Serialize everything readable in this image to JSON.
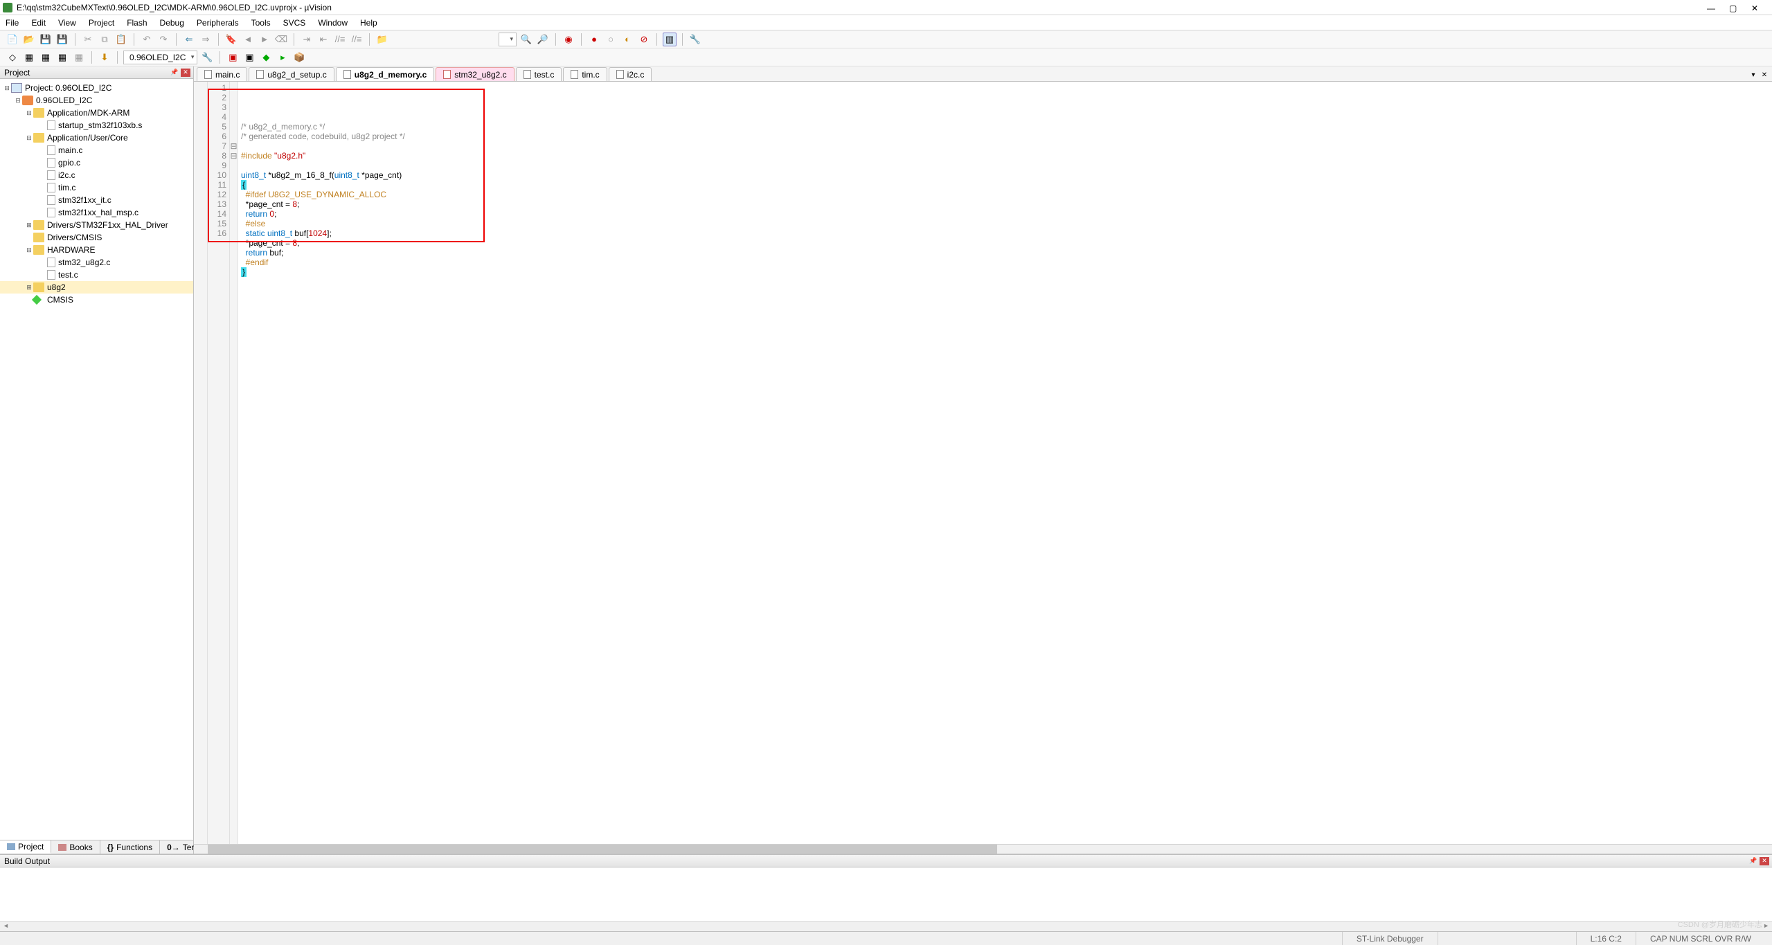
{
  "window": {
    "title": "E:\\qq\\stm32CubeMXText\\0.96OLED_I2C\\MDK-ARM\\0.96OLED_I2C.uvprojx - µVision"
  },
  "menu": [
    "File",
    "Edit",
    "View",
    "Project",
    "Flash",
    "Debug",
    "Peripherals",
    "Tools",
    "SVCS",
    "Window",
    "Help"
  ],
  "target_dropdown": "0.96OLED_I2C",
  "project_panel": {
    "title": "Project",
    "root": "Project: 0.96OLED_I2C",
    "target": "0.96OLED_I2C",
    "groups": [
      {
        "name": "Application/MDK-ARM",
        "expanded": true,
        "files": [
          "startup_stm32f103xb.s"
        ]
      },
      {
        "name": "Application/User/Core",
        "expanded": true,
        "files": [
          "main.c",
          "gpio.c",
          "i2c.c",
          "tim.c",
          "stm32f1xx_it.c",
          "stm32f1xx_hal_msp.c"
        ]
      },
      {
        "name": "Drivers/STM32F1xx_HAL_Driver",
        "expanded": false,
        "files": []
      },
      {
        "name": "Drivers/CMSIS",
        "expanded": false,
        "files": []
      },
      {
        "name": "HARDWARE",
        "expanded": true,
        "files": [
          "stm32_u8g2.c",
          "test.c"
        ]
      },
      {
        "name": "u8g2",
        "expanded": false,
        "files": [],
        "selected": true
      },
      {
        "name": "CMSIS",
        "expanded": false,
        "files": [],
        "diamond": true
      }
    ],
    "footer_tabs": [
      "Project",
      "Books",
      "Functions",
      "Templates"
    ]
  },
  "editor": {
    "tabs": [
      {
        "label": "main.c",
        "kind": "normal"
      },
      {
        "label": "u8g2_d_setup.c",
        "kind": "normal"
      },
      {
        "label": "u8g2_d_memory.c",
        "kind": "active"
      },
      {
        "label": "stm32_u8g2.c",
        "kind": "red"
      },
      {
        "label": "test.c",
        "kind": "normal"
      },
      {
        "label": "tim.c",
        "kind": "normal"
      },
      {
        "label": "i2c.c",
        "kind": "normal"
      }
    ],
    "line_start": 1,
    "code_lines": [
      {
        "n": 1,
        "text": "/* u8g2_d_memory.c */",
        "cls": "comment"
      },
      {
        "n": 2,
        "text": "/* generated code, codebuild, u8g2 project */",
        "cls": "comment"
      },
      {
        "n": 3,
        "text": ""
      },
      {
        "n": 4,
        "text": "#include \"u8g2.h\"",
        "cls": "pp"
      },
      {
        "n": 5,
        "text": ""
      },
      {
        "n": 6,
        "text": "uint8_t *u8g2_m_16_8_f(uint8_t *page_cnt)"
      },
      {
        "n": 7,
        "text": "{",
        "brace_open": true
      },
      {
        "n": 8,
        "text": "  #ifdef U8G2_USE_DYNAMIC_ALLOC",
        "cls": "pp"
      },
      {
        "n": 9,
        "text": "  *page_cnt = 8;"
      },
      {
        "n": 10,
        "text": "  return 0;"
      },
      {
        "n": 11,
        "text": "  #else",
        "cls": "pp"
      },
      {
        "n": 12,
        "text": "  static uint8_t buf[1024];"
      },
      {
        "n": 13,
        "text": "  *page_cnt = 8;"
      },
      {
        "n": 14,
        "text": "  return buf;"
      },
      {
        "n": 15,
        "text": "  #endif",
        "cls": "pp"
      },
      {
        "n": 16,
        "text": "}",
        "brace_close": true
      }
    ]
  },
  "build_output": {
    "title": "Build Output"
  },
  "status": {
    "debugger": "ST-Link Debugger",
    "cursor": "L:16 C:2",
    "indicators": "CAP  NUM  SCRL  OVR  R/W"
  },
  "watermark": "CSDN @岁月磨砺少年志"
}
